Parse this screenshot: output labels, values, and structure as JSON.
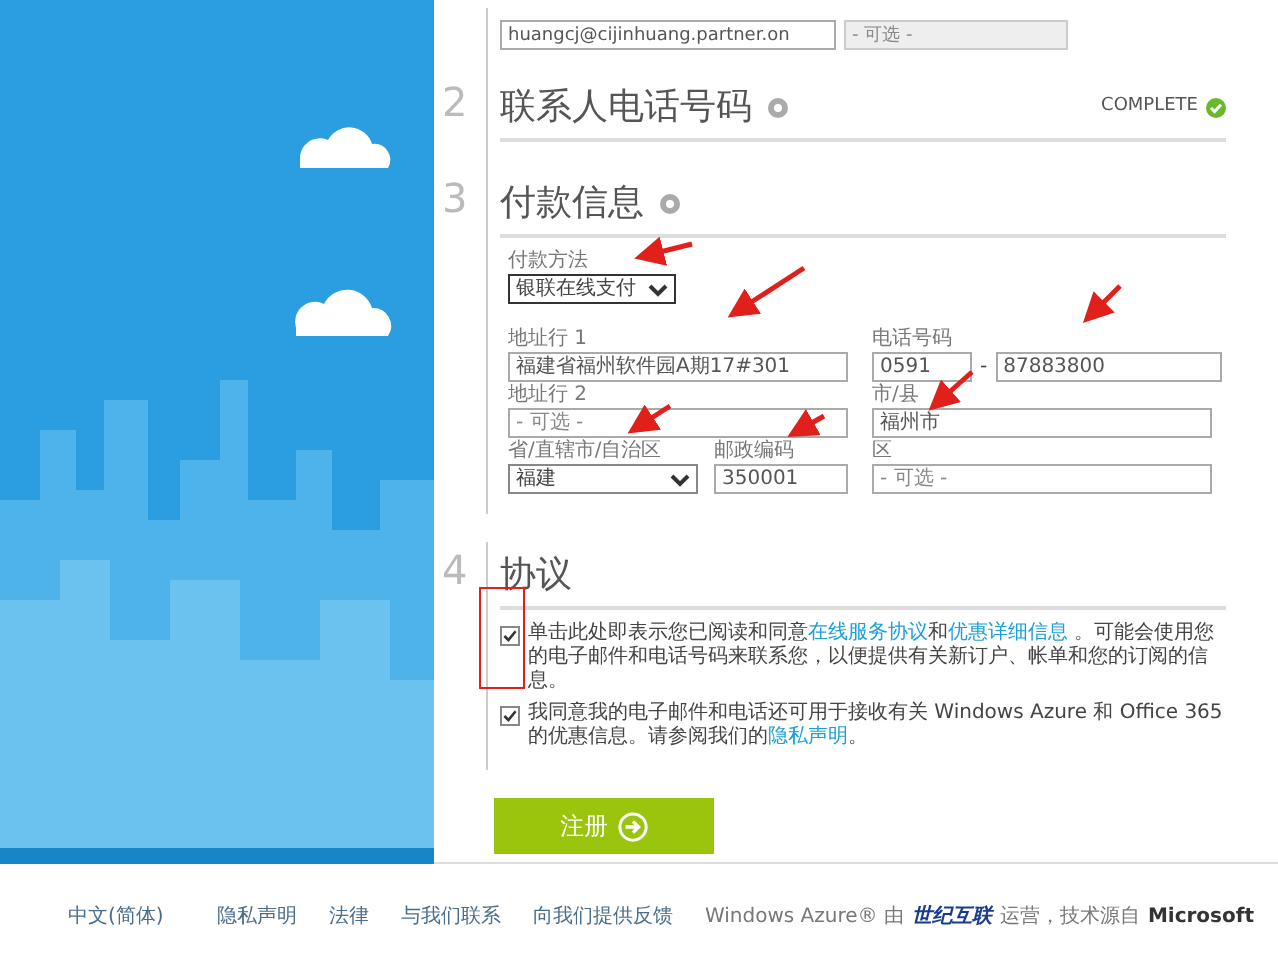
{
  "contact_fields": [
    {
      "value": "huangcj@cijinhuang.partner.on",
      "disabled": false
    },
    {
      "placeholder": "- 可选 -",
      "disabled": true
    }
  ],
  "phone_section": {
    "number": "2",
    "title": "联系人电话号码",
    "status": "COMPLETE"
  },
  "payment_section": {
    "number": "3",
    "title": "付款信息",
    "payment_method": {
      "label": "付款方法",
      "value": "银联在线支付"
    },
    "address_1": {
      "label": "地址行 1",
      "value": "福建省福州软件园A期17#301"
    },
    "phone": {
      "label": "电话号码",
      "area_code": "0591",
      "separator": "-",
      "number": "87883800"
    },
    "address_2": {
      "label": "地址行 2",
      "placeholder": "- 可选 -"
    },
    "city": {
      "label": "市/县",
      "value": "福州市"
    },
    "province": {
      "label": "省/直辖市/自治区",
      "value": "福建"
    },
    "postal_code": {
      "label": "邮政编码",
      "value": "350001"
    },
    "district": {
      "label": "区",
      "placeholder": "- 可选 -"
    }
  },
  "agreement_section": {
    "number": "4",
    "title": "协议",
    "checkboxes": [
      {
        "checked": true,
        "parts": [
          {
            "text": "单击此处即表示您已阅读和同意",
            "kind": "text"
          },
          {
            "text": "在线服务协议",
            "kind": "link"
          },
          {
            "text": "和",
            "kind": "text"
          },
          {
            "text": "优惠详细信息",
            "kind": "link"
          },
          {
            "text": " 。可能会使用您的电子邮件和电话号码来联系您，以便提供有关新订户、帐单和您的订阅的信息。",
            "kind": "text"
          }
        ]
      },
      {
        "checked": true,
        "parts": [
          {
            "text": "我同意我的电子邮件和电话还可用于接收有关 Windows Azure 和 Office 365 的优惠信息。请参阅我们的",
            "kind": "text"
          },
          {
            "text": "隐私声明",
            "kind": "link"
          },
          {
            "text": "。",
            "kind": "text"
          }
        ]
      }
    ]
  },
  "submit_button": {
    "label": "注册"
  },
  "footer": {
    "language": "中文(简体)",
    "links": [
      "隐私声明",
      "法律",
      "与我们联系",
      "向我们提供反馈"
    ],
    "operated_by": "Windows Azure® 由",
    "operator": "世纪互联",
    "tech_note": "运营，技术源自",
    "company": "Microsoft"
  }
}
